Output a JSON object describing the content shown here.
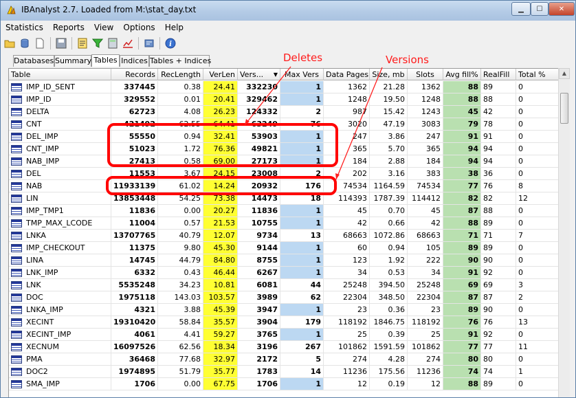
{
  "window": {
    "title": "IBAnalyst 2.7. Loaded from M:\\stat_day.txt",
    "minimize_glyph": "▁",
    "maximize_glyph": "☐",
    "close_glyph": "✕"
  },
  "menu": [
    "Statistics",
    "Reports",
    "View",
    "Options",
    "Help"
  ],
  "toolbar_icons": [
    "open-folder-icon",
    "database-icon",
    "document-icon",
    "save-icon",
    "report-icon",
    "filter-icon",
    "calculator-icon",
    "chart-icon",
    "settings-icon",
    "info-icon"
  ],
  "tabs": [
    "Databases",
    "Summary",
    "Tables",
    "Indices",
    "Tables + Indices"
  ],
  "active_tab": "Tables",
  "columns": [
    "Table",
    "Records",
    "RecLength",
    "VerLen",
    "Vers...",
    "Max Vers",
    "Data Pages",
    "Size, mb",
    "Slots",
    "Avg fill%",
    "RealFill",
    "Total %"
  ],
  "rows": [
    {
      "table": "IMP_ID_SENT",
      "records": "337445",
      "reclength": "0.38",
      "verlen": "24.41",
      "vers": "332230",
      "maxvers": "1",
      "datapages": "1362",
      "size": "21.28",
      "slots": "1362",
      "avgfill": "88",
      "realfill": "89",
      "total": "0"
    },
    {
      "table": "IMP_ID",
      "records": "329552",
      "reclength": "0.01",
      "verlen": "20.41",
      "vers": "329462",
      "maxvers": "1",
      "datapages": "1248",
      "size": "19.50",
      "slots": "1248",
      "avgfill": "88",
      "realfill": "88",
      "total": "0"
    },
    {
      "table": "DELTA",
      "records": "62723",
      "reclength": "4.08",
      "verlen": "26.23",
      "vers": "124332",
      "maxvers": "2",
      "datapages": "987",
      "size": "15.42",
      "slots": "1243",
      "avgfill": "45",
      "realfill": "42",
      "total": "0"
    },
    {
      "table": "CNT",
      "records": "421492",
      "reclength": "62.55",
      "verlen": "64.41",
      "vers": "63249",
      "maxvers": "76",
      "datapages": "3020",
      "size": "47.19",
      "slots": "3083",
      "avgfill": "79",
      "realfill": "78",
      "total": "0"
    },
    {
      "table": "DEL_IMP",
      "records": "55550",
      "reclength": "0.94",
      "verlen": "32.41",
      "vers": "53903",
      "maxvers": "1",
      "datapages": "247",
      "size": "3.86",
      "slots": "247",
      "avgfill": "91",
      "realfill": "91",
      "total": "0"
    },
    {
      "table": "CNT_IMP",
      "records": "51023",
      "reclength": "1.72",
      "verlen": "76.36",
      "vers": "49821",
      "maxvers": "1",
      "datapages": "365",
      "size": "5.70",
      "slots": "365",
      "avgfill": "94",
      "realfill": "94",
      "total": "0"
    },
    {
      "table": "NAB_IMP",
      "records": "27413",
      "reclength": "0.58",
      "verlen": "69.00",
      "vers": "27173",
      "maxvers": "1",
      "datapages": "184",
      "size": "2.88",
      "slots": "184",
      "avgfill": "94",
      "realfill": "94",
      "total": "0"
    },
    {
      "table": "DEL",
      "records": "11553",
      "reclength": "3.67",
      "verlen": "24.15",
      "vers": "23008",
      "maxvers": "2",
      "datapages": "202",
      "size": "3.16",
      "slots": "383",
      "avgfill": "38",
      "realfill": "36",
      "total": "0"
    },
    {
      "table": "NAB",
      "records": "11933139",
      "reclength": "61.02",
      "verlen": "14.24",
      "vers": "20932",
      "maxvers": "176",
      "datapages": "74534",
      "size": "1164.59",
      "slots": "74534",
      "avgfill": "77",
      "realfill": "76",
      "total": "8"
    },
    {
      "table": "LIN",
      "records": "13853448",
      "reclength": "54.25",
      "verlen": "73.38",
      "vers": "14473",
      "maxvers": "18",
      "datapages": "114393",
      "size": "1787.39",
      "slots": "114412",
      "avgfill": "82",
      "realfill": "82",
      "total": "12"
    },
    {
      "table": "IMP_TMP1",
      "records": "11836",
      "reclength": "0.00",
      "verlen": "20.27",
      "vers": "11836",
      "maxvers": "1",
      "datapages": "45",
      "size": "0.70",
      "slots": "45",
      "avgfill": "87",
      "realfill": "88",
      "total": "0"
    },
    {
      "table": "TMP_MAX_LCODE",
      "records": "11004",
      "reclength": "0.57",
      "verlen": "21.53",
      "vers": "10755",
      "maxvers": "1",
      "datapages": "42",
      "size": "0.66",
      "slots": "42",
      "avgfill": "88",
      "realfill": "89",
      "total": "0"
    },
    {
      "table": "LNKA",
      "records": "13707765",
      "reclength": "40.79",
      "verlen": "12.07",
      "vers": "9734",
      "maxvers": "13",
      "datapages": "68663",
      "size": "1072.86",
      "slots": "68663",
      "avgfill": "71",
      "realfill": "71",
      "total": "7"
    },
    {
      "table": "IMP_CHECKOUT",
      "records": "11375",
      "reclength": "9.80",
      "verlen": "45.30",
      "vers": "9144",
      "maxvers": "1",
      "datapages": "60",
      "size": "0.94",
      "slots": "105",
      "avgfill": "89",
      "realfill": "89",
      "total": "0"
    },
    {
      "table": "LINA",
      "records": "14745",
      "reclength": "44.79",
      "verlen": "84.80",
      "vers": "8755",
      "maxvers": "1",
      "datapages": "123",
      "size": "1.92",
      "slots": "222",
      "avgfill": "90",
      "realfill": "90",
      "total": "0"
    },
    {
      "table": "LNK_IMP",
      "records": "6332",
      "reclength": "0.43",
      "verlen": "46.44",
      "vers": "6267",
      "maxvers": "1",
      "datapages": "34",
      "size": "0.53",
      "slots": "34",
      "avgfill": "91",
      "realfill": "92",
      "total": "0"
    },
    {
      "table": "LNK",
      "records": "5535248",
      "reclength": "34.23",
      "verlen": "10.81",
      "vers": "6081",
      "maxvers": "44",
      "datapages": "25248",
      "size": "394.50",
      "slots": "25248",
      "avgfill": "69",
      "realfill": "69",
      "total": "3"
    },
    {
      "table": "DOC",
      "records": "1975118",
      "reclength": "143.03",
      "verlen": "103.57",
      "vers": "3989",
      "maxvers": "62",
      "datapages": "22304",
      "size": "348.50",
      "slots": "22304",
      "avgfill": "87",
      "realfill": "87",
      "total": "2"
    },
    {
      "table": "LNKA_IMP",
      "records": "4321",
      "reclength": "3.88",
      "verlen": "45.39",
      "vers": "3947",
      "maxvers": "1",
      "datapages": "23",
      "size": "0.36",
      "slots": "23",
      "avgfill": "89",
      "realfill": "90",
      "total": "0"
    },
    {
      "table": "XECINT",
      "records": "19310420",
      "reclength": "58.84",
      "verlen": "35.57",
      "vers": "3904",
      "maxvers": "179",
      "datapages": "118192",
      "size": "1846.75",
      "slots": "118192",
      "avgfill": "76",
      "realfill": "76",
      "total": "13"
    },
    {
      "table": "XECINT_IMP",
      "records": "4061",
      "reclength": "4.41",
      "verlen": "59.27",
      "vers": "3765",
      "maxvers": "1",
      "datapages": "25",
      "size": "0.39",
      "slots": "25",
      "avgfill": "91",
      "realfill": "92",
      "total": "0"
    },
    {
      "table": "XECNUM",
      "records": "16097526",
      "reclength": "62.56",
      "verlen": "18.34",
      "vers": "3196",
      "maxvers": "267",
      "datapages": "101862",
      "size": "1591.59",
      "slots": "101862",
      "avgfill": "77",
      "realfill": "77",
      "total": "11"
    },
    {
      "table": "PMA",
      "records": "36468",
      "reclength": "77.68",
      "verlen": "32.97",
      "vers": "2172",
      "maxvers": "5",
      "datapages": "274",
      "size": "4.28",
      "slots": "274",
      "avgfill": "80",
      "realfill": "80",
      "total": "0"
    },
    {
      "table": "DOC2",
      "records": "1974895",
      "reclength": "51.79",
      "verlen": "35.77",
      "vers": "1783",
      "maxvers": "14",
      "datapages": "11236",
      "size": "175.56",
      "slots": "11236",
      "avgfill": "74",
      "realfill": "74",
      "total": "1"
    },
    {
      "table": "SMA_IMP",
      "records": "1706",
      "reclength": "0.00",
      "verlen": "67.75",
      "vers": "1706",
      "maxvers": "1",
      "datapages": "12",
      "size": "0.19",
      "slots": "12",
      "avgfill": "88",
      "realfill": "89",
      "total": "0"
    }
  ],
  "highlight_colors": {
    "verlen": "#ffff33",
    "maxvers": "#bcd8f2",
    "avgfill": "#b9e0b0",
    "annotation": "#ff0000"
  },
  "annotations": {
    "deletes_label": "Deletes",
    "versions_label": "Versions"
  }
}
